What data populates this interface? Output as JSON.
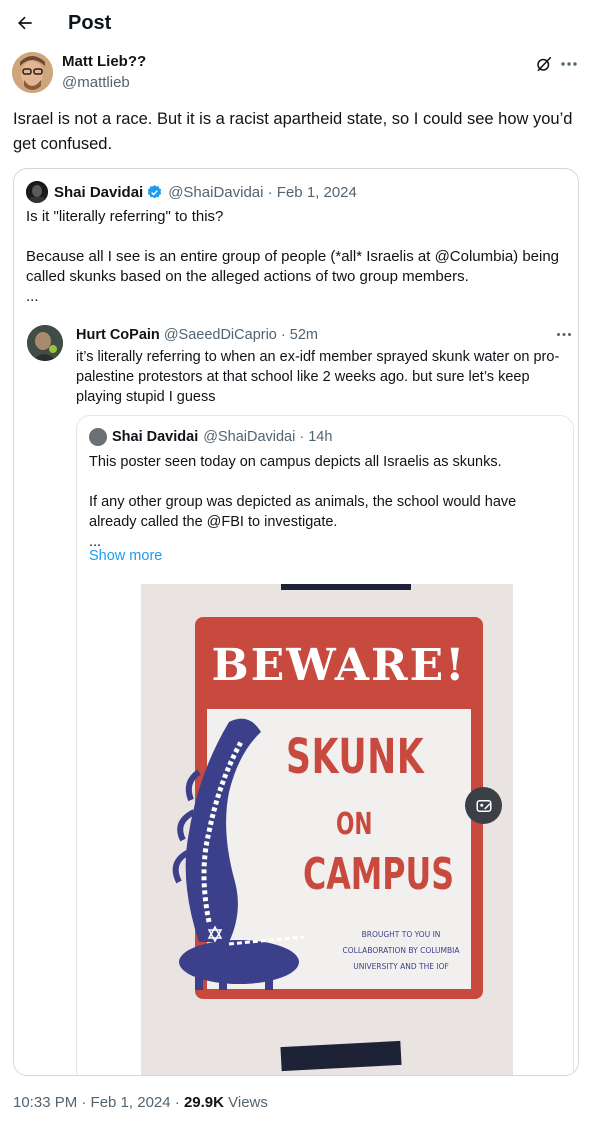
{
  "header": {
    "title": "Post"
  },
  "post": {
    "author_name": "Matt Lieb??",
    "author_handle": "@mattlieb",
    "text": "Israel is not a race. But it is a racist apartheid state, so I could see how you’d get confused.",
    "timestamp": "10:33 PM · Feb 1, 2024 · ",
    "views_count": "29.9K",
    "views_label": " Views"
  },
  "quote": {
    "name": "Shai Davidai",
    "handle_meta": "@ShaiDavidai · Feb 1, 2024",
    "text": "Is it \"literally referring\" to this?\n\nBecause all I see is an entire group of people (*all* Israelis at @Columbia) being called skunks based on the alleged actions of two group members.\n..."
  },
  "reply": {
    "name": "Hurt CoPain",
    "handle_meta": "@SaeedDiCaprio · 52m",
    "text": "it’s literally referring to when an ex-idf member sprayed skunk water on pro-palestine protestors at that school like 2 weeks ago. but sure let’s keep playing stupid I guess"
  },
  "inner_quote": {
    "name": "Shai Davidai",
    "handle_meta": "@ShaiDavidai · 14h",
    "text": "This poster seen today on campus depicts all Israelis as skunks.\n\nIf any other group was depicted as animals, the school would have already called the @FBI to investigate.\n...",
    "show_more": "Show more"
  },
  "poster": {
    "beware": "BEWARE!",
    "skunk": "SKUNK",
    "on": "ON",
    "campus": "CAMPUS",
    "brought": "BROUGHT TO YOU IN COLLABORATION BY COLUMBIA UNIVERSITY AND THE IOF"
  },
  "colors": {
    "link": "#1d9bf0",
    "verified": "#1d9bf0",
    "poster_red": "#c8493e",
    "skunk_blue": "#3c3f8a"
  },
  "icons": [
    "back-arrow-icon",
    "grok-icon",
    "more-icon",
    "verified-badge-icon",
    "alt-text-icon"
  ]
}
